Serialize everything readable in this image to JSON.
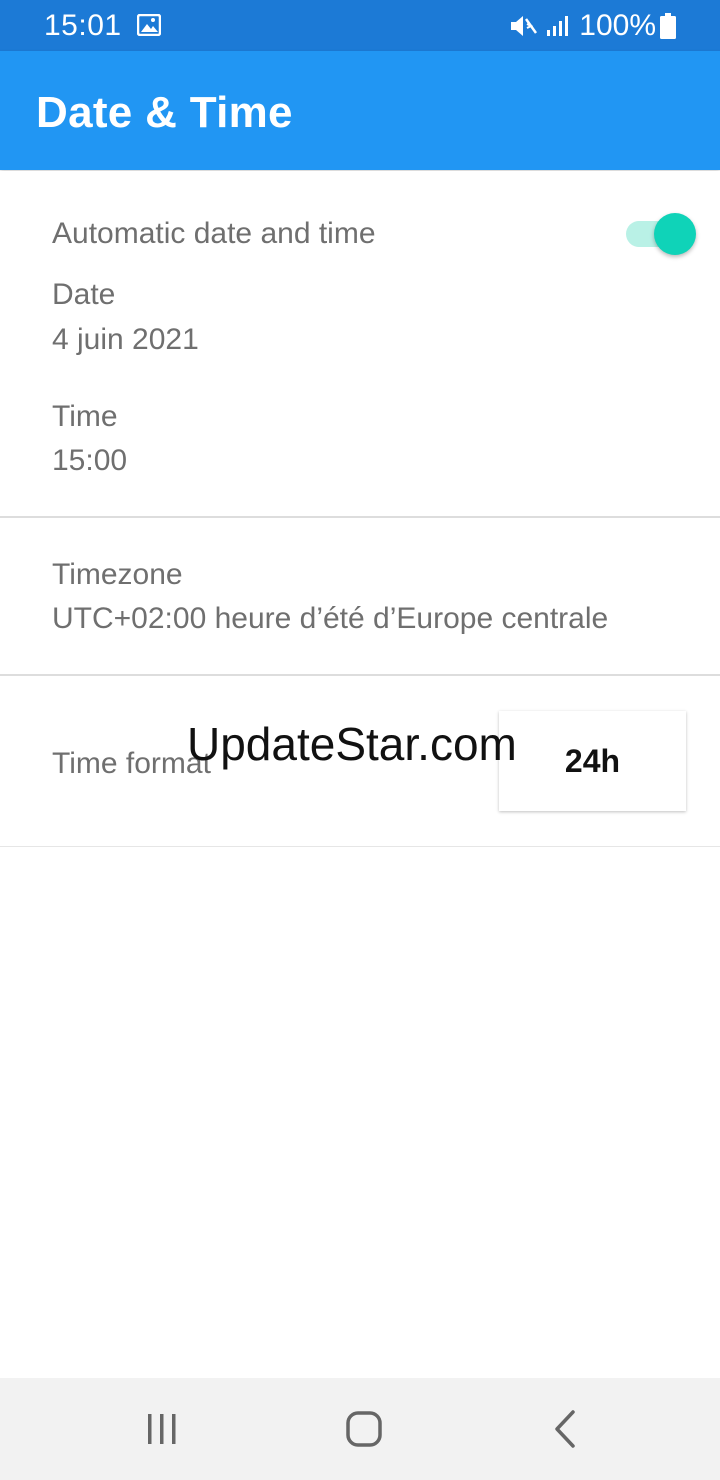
{
  "status_bar": {
    "time": "15:01",
    "battery": "100%",
    "icons": [
      "gallery-icon",
      "mute-icon",
      "signal-icon",
      "battery-icon"
    ]
  },
  "app_bar": {
    "title": "Date & Time",
    "color": "#2196f3"
  },
  "settings": {
    "automatic": {
      "label": "Automatic date and time",
      "enabled": true
    },
    "date": {
      "label": "Date",
      "value": "4 juin 2021"
    },
    "time": {
      "label": "Time",
      "value": "15:00"
    },
    "timezone": {
      "label": "Timezone",
      "value": "UTC+02:00 heure d’été d’Europe centrale"
    },
    "time_format": {
      "label": "Time format",
      "value": "24h"
    }
  },
  "watermark": "UpdateStar.com",
  "nav_bar": {
    "icons": [
      "recents-icon",
      "home-icon",
      "back-icon"
    ]
  },
  "colors": {
    "status_bar": "#1c7ad6",
    "toggle_on": "#0fd3b8",
    "toggle_track": "#b9f1e6",
    "text_secondary": "#6f6f6f"
  }
}
